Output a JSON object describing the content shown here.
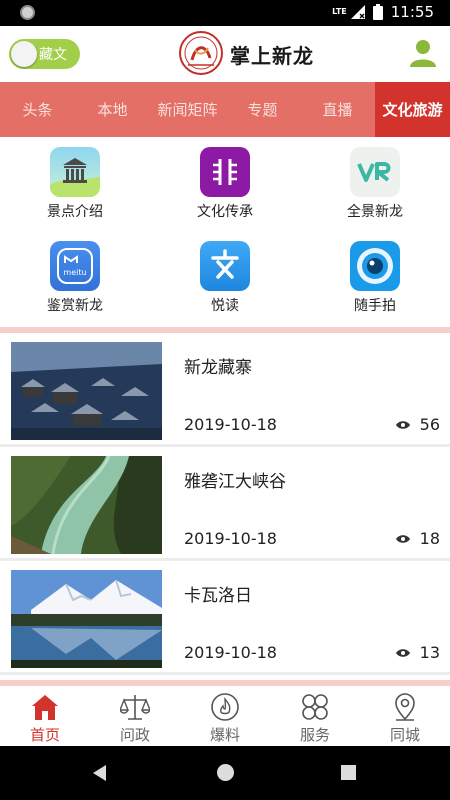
{
  "status_bar": {
    "network": "LTE",
    "time": "11:55"
  },
  "header": {
    "toggle_label": "藏文",
    "title": "掌上新龙",
    "logo_icon": "app-logo-seal",
    "user_icon": "user-icon"
  },
  "tabs": [
    {
      "label": "头条",
      "active": false
    },
    {
      "label": "本地",
      "active": false
    },
    {
      "label": "新闻矩阵",
      "active": false
    },
    {
      "label": "专题",
      "active": false
    },
    {
      "label": "直播",
      "active": false
    },
    {
      "label": "文化旅游",
      "active": true
    }
  ],
  "features": [
    {
      "label": "景点介绍",
      "icon": "temple-icon"
    },
    {
      "label": "文化传承",
      "icon": "culture-icon"
    },
    {
      "label": "全景新龙",
      "icon": "vr-icon"
    },
    {
      "label": "鉴赏新龙",
      "icon": "meitu-icon"
    },
    {
      "label": "悦读",
      "icon": "reading-icon"
    },
    {
      "label": "随手拍",
      "icon": "camera-icon"
    }
  ],
  "news": [
    {
      "title": "新龙藏寨",
      "date": "2019-10-18",
      "views": "56"
    },
    {
      "title": "雅砻江大峡谷",
      "date": "2019-10-18",
      "views": "18"
    },
    {
      "title": "卡瓦洛日",
      "date": "2019-10-18",
      "views": "13"
    }
  ],
  "bottom_nav": [
    {
      "label": "首页",
      "icon": "home-icon",
      "active": true
    },
    {
      "label": "问政",
      "icon": "scales-icon",
      "active": false
    },
    {
      "label": "爆料",
      "icon": "flame-icon",
      "active": false
    },
    {
      "label": "服务",
      "icon": "grid-icon",
      "active": false
    },
    {
      "label": "同城",
      "icon": "location-pin-icon",
      "active": false
    }
  ],
  "colors": {
    "accent": "#d2332c",
    "tab_bar": "#e36f66",
    "toggle": "#a2cf4a",
    "divider": "#f5cfca"
  }
}
